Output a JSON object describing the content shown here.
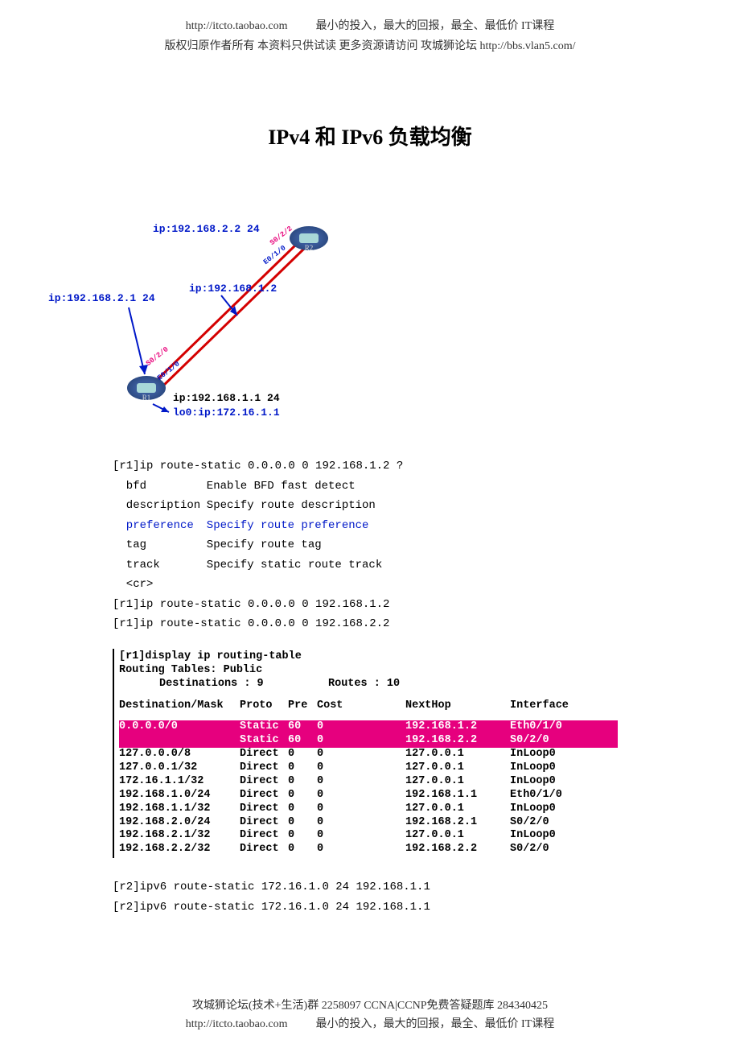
{
  "header": {
    "url1": "http://itcto.taobao.com",
    "slogan": "最小的投入，最大的回报，最全、最低价 IT课程",
    "copyright": "版权归原作者所有 本资料只供试读 更多资源请访问 攻城狮论坛 http://bbs.vlan5.com/"
  },
  "title": "IPv4 和 IPv6 负载均衡",
  "diagram": {
    "r1_label": "R1",
    "r2_label": "R2",
    "ip22": "ip:192.168.2.2 24",
    "ip21": "ip:192.168.2.1 24",
    "ip12": "ip:192.168.1.2",
    "ip11": "ip:192.168.1.1 24",
    "lo0": "lo0:ip:172.16.1.1",
    "if_s022": "S0/2/2",
    "if_e010_r2": "E0/1/0",
    "if_s020": "S0/2/0",
    "if_e010_r1": "E0/1/0"
  },
  "cli": {
    "cmd_prompt": "[r1]ip route-static 0.0.0.0 0 192.168.1.2 ?",
    "opts": [
      {
        "k": "bfd",
        "d": "Enable BFD fast detect",
        "blue": false
      },
      {
        "k": "description",
        "d": "Specify route description",
        "blue": false
      },
      {
        "k": "preference",
        "d": "Specify route preference",
        "blue": true
      },
      {
        "k": "tag",
        "d": "Specify route tag",
        "blue": false
      },
      {
        "k": "track",
        "d": "Specify static route track",
        "blue": false
      },
      {
        "k": "<cr>",
        "d": "",
        "blue": false
      }
    ],
    "cmd1": "[r1]ip route-static 0.0.0.0 0 192.168.1.2",
    "cmd2": "[r1]ip route-static 0.0.0.0 0 192.168.2.2"
  },
  "routing": {
    "line1": "[r1]display ip routing-table",
    "line2": "Routing Tables: Public",
    "dest_label": "Destinations : 9",
    "routes_label": "Routes : 10",
    "headers": {
      "dest": "Destination/Mask",
      "proto": "Proto",
      "pre": "Pre",
      "cost": "Cost",
      "next": "NextHop",
      "if": "Interface"
    },
    "rows": [
      {
        "dest": "0.0.0.0/0",
        "proto": "Static",
        "pre": "60",
        "cost": "0",
        "next": "192.168.1.2",
        "if": "Eth0/1/0",
        "hl": true
      },
      {
        "dest": "",
        "proto": "Static",
        "pre": "60",
        "cost": "0",
        "next": "192.168.2.2",
        "if": "S0/2/0",
        "hl": true
      },
      {
        "dest": "127.0.0.0/8",
        "proto": "Direct",
        "pre": "0",
        "cost": "0",
        "next": "127.0.0.1",
        "if": "InLoop0",
        "hl": false
      },
      {
        "dest": "127.0.0.1/32",
        "proto": "Direct",
        "pre": "0",
        "cost": "0",
        "next": "127.0.0.1",
        "if": "InLoop0",
        "hl": false
      },
      {
        "dest": "172.16.1.1/32",
        "proto": "Direct",
        "pre": "0",
        "cost": "0",
        "next": "127.0.0.1",
        "if": "InLoop0",
        "hl": false
      },
      {
        "dest": "192.168.1.0/24",
        "proto": "Direct",
        "pre": "0",
        "cost": "0",
        "next": "192.168.1.1",
        "if": "Eth0/1/0",
        "hl": false
      },
      {
        "dest": "192.168.1.1/32",
        "proto": "Direct",
        "pre": "0",
        "cost": "0",
        "next": "127.0.0.1",
        "if": "InLoop0",
        "hl": false
      },
      {
        "dest": "192.168.2.0/24",
        "proto": "Direct",
        "pre": "0",
        "cost": "0",
        "next": "192.168.2.1",
        "if": "S0/2/0",
        "hl": false
      },
      {
        "dest": "192.168.2.1/32",
        "proto": "Direct",
        "pre": "0",
        "cost": "0",
        "next": "127.0.0.1",
        "if": "InLoop0",
        "hl": false
      },
      {
        "dest": "192.168.2.2/32",
        "proto": "Direct",
        "pre": "0",
        "cost": "0",
        "next": "192.168.2.2",
        "if": "S0/2/0",
        "hl": false
      }
    ]
  },
  "cli2": {
    "cmd1": "[r2]ipv6 route-static 172.16.1.0 24 192.168.1.1",
    "cmd2": "[r2]ipv6 route-static 172.16.1.0 24 192.168.1.1"
  },
  "footer": {
    "line1": "攻城狮论坛(技术+生活)群 2258097 CCNA|CCNP免费答疑题库 284340425",
    "url": "http://itcto.taobao.com",
    "slogan": "最小的投入，最大的回报，最全、最低价 IT课程"
  }
}
